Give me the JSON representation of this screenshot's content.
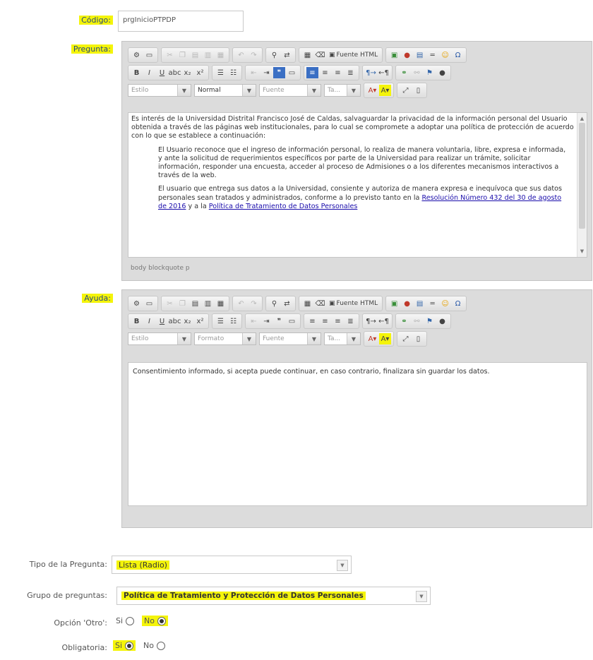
{
  "codigo": {
    "label": "Código:",
    "value": "prgInicioPTPDP"
  },
  "preguntas": {
    "label": "Pregunta:",
    "toolbar": {
      "source_label": "Fuente HTML",
      "style_combo": "Estilo",
      "format_combo": "Normal",
      "font_combo": "Fuente",
      "size_combo": "Ta..."
    },
    "paragraph1": "Es interés de la Universidad Distrital Francisco José de Caldas, salvaguardar la privacidad de la información personal del Usuario obtenida a través de las páginas web institucionales, para lo cual se compromete a adoptar una política de protección de acuerdo con lo que se establece a continuación:",
    "quote1": "El Usuario reconoce que el ingreso de información personal, lo realiza de manera voluntaria, libre, expresa e informada, y ante la solicitud de requerimientos específicos por parte de la Universidad para realizar un trámite, solicitar información, responder una encuesta, acceder al proceso de Admisiones o a los diferentes mecanismos interactivos a través de la web.",
    "quote2_text": "El usuario que entrega sus datos a la Universidad, consiente y autoriza de manera expresa e inequívoca que sus datos personales sean tratados y administrados, conforme a lo previsto tanto en la ",
    "quote2_link1": "Resolución Número 432 del 30 de agosto de 2016",
    "quote2_mid": " y a la ",
    "quote2_link2": "Política de Tratamiento de Datos Personales",
    "path": "body  blockquote  p"
  },
  "ayuda": {
    "label": "Ayuda:",
    "toolbar": {
      "source_label": "Fuente HTML",
      "style_combo": "Estilo",
      "format_combo": "Formato",
      "font_combo": "Fuente",
      "size_combo": "Ta..."
    },
    "text": "Consentimiento informado, si acepta puede continuar, en caso contrario, finalizara sin guardar los datos."
  },
  "tipo": {
    "label": "Tipo de la Pregunta:",
    "value": "Lista (Radio)"
  },
  "grupo": {
    "label": "Grupo de preguntas:",
    "value": "Política de Tratamiento y Protección de Datos Personales"
  },
  "opcion_otro": {
    "label": "Opción 'Otro':",
    "yes": "Si",
    "no": "No",
    "selected": "No"
  },
  "obligatoria": {
    "label": "Obligatoria:",
    "yes": "Si",
    "no": "No",
    "selected": "Si"
  }
}
